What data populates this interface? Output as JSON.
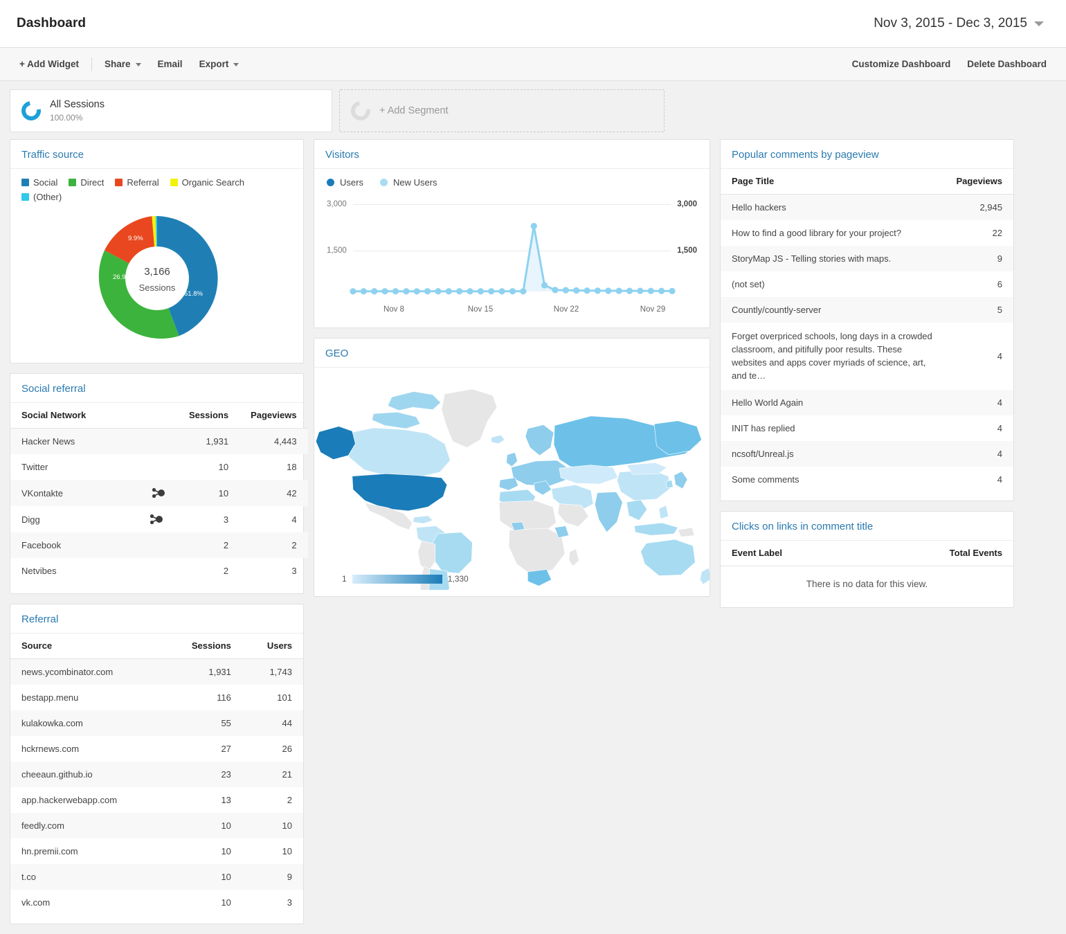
{
  "header": {
    "title": "Dashboard",
    "date_range": "Nov 3, 2015 - Dec 3, 2015"
  },
  "toolbar": {
    "add_widget": "+ Add Widget",
    "share": "Share",
    "email": "Email",
    "export": "Export",
    "customize": "Customize Dashboard",
    "delete": "Delete Dashboard"
  },
  "segments": {
    "all_sessions": {
      "name": "All Sessions",
      "percent": "100.00%"
    },
    "add_segment": "+ Add Segment"
  },
  "traffic_source": {
    "title": "Traffic source",
    "center_value": "3,166",
    "center_label": "Sessions"
  },
  "visitors": {
    "title": "Visitors"
  },
  "geo": {
    "title": "GEO",
    "legend_min": "1",
    "legend_max": "1,330"
  },
  "social_referral": {
    "title": "Social referral",
    "columns": [
      "Social Network",
      "Sessions",
      "Pageviews"
    ],
    "rows": [
      {
        "network": "Hacker News",
        "icon": "",
        "sessions": "1,931",
        "pageviews": "4,443"
      },
      {
        "network": "Twitter",
        "icon": "",
        "sessions": "10",
        "pageviews": "18"
      },
      {
        "network": "VKontakte",
        "icon": "share-network-icon",
        "sessions": "10",
        "pageviews": "42"
      },
      {
        "network": "Digg",
        "icon": "share-network-icon",
        "sessions": "3",
        "pageviews": "4"
      },
      {
        "network": "Facebook",
        "icon": "",
        "sessions": "2",
        "pageviews": "2"
      },
      {
        "network": "Netvibes",
        "icon": "",
        "sessions": "2",
        "pageviews": "3"
      }
    ]
  },
  "referral": {
    "title": "Referral",
    "columns": [
      "Source",
      "Sessions",
      "Users"
    ],
    "rows": [
      {
        "source": "news.ycombinator.com",
        "sessions": "1,931",
        "users": "1,743"
      },
      {
        "source": "bestapp.menu",
        "sessions": "116",
        "users": "101"
      },
      {
        "source": "kulakowka.com",
        "sessions": "55",
        "users": "44"
      },
      {
        "source": "hckrnews.com",
        "sessions": "27",
        "users": "26"
      },
      {
        "source": "cheeaun.github.io",
        "sessions": "23",
        "users": "21"
      },
      {
        "source": "app.hackerwebapp.com",
        "sessions": "13",
        "users": "2"
      },
      {
        "source": "feedly.com",
        "sessions": "10",
        "users": "10"
      },
      {
        "source": "hn.premii.com",
        "sessions": "10",
        "users": "10"
      },
      {
        "source": "t.co",
        "sessions": "10",
        "users": "9"
      },
      {
        "source": "vk.com",
        "sessions": "10",
        "users": "3"
      }
    ]
  },
  "popular_comments": {
    "title": "Popular comments by pageview",
    "columns": [
      "Page Title",
      "Pageviews"
    ],
    "rows": [
      {
        "title": "Hello hackers",
        "pageviews": "2,945"
      },
      {
        "title": "How to find a good library for your project?",
        "pageviews": "22"
      },
      {
        "title": "StoryMap JS - Telling stories with maps.",
        "pageviews": "9"
      },
      {
        "title": "(not set)",
        "pageviews": "6"
      },
      {
        "title": "Countly/countly-server",
        "pageviews": "5"
      },
      {
        "title": "Forget overpriced schools, long days in a crowded classroom, and pitifully poor results. These websites and apps cover myriads of science, art, and te…",
        "pageviews": "4"
      },
      {
        "title": "Hello World Again",
        "pageviews": "4"
      },
      {
        "title": "INIT has replied",
        "pageviews": "4"
      },
      {
        "title": "ncsoft/Unreal.js",
        "pageviews": "4"
      },
      {
        "title": "Some comments",
        "pageviews": "4"
      }
    ]
  },
  "clicks_widget": {
    "title": "Clicks on links in comment title",
    "columns": [
      "Event Label",
      "Total Events"
    ],
    "empty_message": "There is no data for this view."
  },
  "chart_data": [
    {
      "type": "pie",
      "title": "Traffic source",
      "labels": [
        "Social",
        "Direct",
        "Referral",
        "Organic Search",
        "(Other)"
      ],
      "values": [
        61.8,
        26.9,
        9.9,
        1.1,
        0.3
      ],
      "value_labels": [
        "61.8%",
        "26.9%",
        "9.9%",
        "",
        ""
      ],
      "colors": [
        "#1f7fb5",
        "#3cb33c",
        "#e8471f",
        "#f2f20d",
        "#2fc9ea"
      ],
      "center_value": "3,166",
      "center_label": "Sessions",
      "legend": "top",
      "donut": true
    },
    {
      "type": "line",
      "title": "Visitors",
      "xlabel": "",
      "ylabel": "",
      "ylim": [
        0,
        3000
      ],
      "yticks": [
        1500,
        3000
      ],
      "ytick_labels": [
        "1,500",
        "3,000"
      ],
      "grid": true,
      "legend": "top",
      "x_tick_labels": [
        "Nov 8",
        "Nov 15",
        "Nov 22",
        "Nov 29"
      ],
      "x_tick_indices": [
        5,
        12,
        19,
        26
      ],
      "x": [
        "Nov 3",
        "Nov 4",
        "Nov 5",
        "Nov 6",
        "Nov 7",
        "Nov 8",
        "Nov 9",
        "Nov 10",
        "Nov 11",
        "Nov 12",
        "Nov 13",
        "Nov 14",
        "Nov 15",
        "Nov 16",
        "Nov 17",
        "Nov 18",
        "Nov 19",
        "Nov 20",
        "Nov 21",
        "Nov 22",
        "Nov 23",
        "Nov 24",
        "Nov 25",
        "Nov 26",
        "Nov 27",
        "Nov 28",
        "Nov 29",
        "Nov 30",
        "Dec 1",
        "Dec 2",
        "Dec 3"
      ],
      "series": [
        {
          "name": "Users",
          "color": "#1a7cb8",
          "values": [
            6,
            8,
            7,
            9,
            8,
            7,
            6,
            9,
            8,
            7,
            9,
            8,
            7,
            8,
            6,
            9,
            8,
            2280,
            230,
            60,
            55,
            40,
            35,
            30,
            28,
            26,
            25,
            24,
            22,
            20,
            18
          ]
        },
        {
          "name": "New Users",
          "color": "#8ed2f0",
          "values": [
            5,
            7,
            6,
            8,
            7,
            6,
            5,
            8,
            7,
            6,
            8,
            7,
            6,
            7,
            5,
            8,
            7,
            2250,
            215,
            50,
            45,
            35,
            30,
            26,
            24,
            22,
            21,
            20,
            19,
            17,
            15
          ]
        }
      ]
    },
    {
      "type": "heatmap",
      "title": "GEO",
      "subtype": "choropleth-world-map",
      "legend_min": 1,
      "legend_max": 1330,
      "legend_min_label": "1",
      "legend_max_label": "1,330",
      "color_scale": [
        "#d7edfb",
        "#1a7cb8"
      ],
      "no_data_color": "#e6e6e6",
      "highlighted_regions": [
        {
          "name": "United States",
          "value": 1330,
          "color": "#1a7cb8"
        },
        {
          "name": "Alaska",
          "value": 1330,
          "color": "#1a7cb8"
        },
        {
          "name": "Russia",
          "value": 400,
          "color": "#6dc1e8"
        },
        {
          "name": "Canada",
          "value": 260,
          "color": "#9fd6ef"
        },
        {
          "name": "Europe",
          "value": 200,
          "color": "#8ecdec"
        },
        {
          "name": "India",
          "value": 150,
          "color": "#8ecdec"
        },
        {
          "name": "Australia",
          "value": 120,
          "color": "#a7dbf1"
        },
        {
          "name": "Brazil",
          "value": 100,
          "color": "#a7dbf1"
        },
        {
          "name": "China",
          "value": 90,
          "color": "#bfe4f6"
        },
        {
          "name": "Greenland",
          "value": 0,
          "color": "#e6e6e6"
        },
        {
          "name": "Africa (most)",
          "value": 0,
          "color": "#e6e6e6"
        }
      ]
    },
    {
      "type": "table",
      "title": "Social referral",
      "columns": [
        "Social Network",
        "Sessions",
        "Pageviews"
      ],
      "rows": [
        [
          "Hacker News",
          "1,931",
          "4,443"
        ],
        [
          "Twitter",
          "10",
          "18"
        ],
        [
          "VKontakte",
          "10",
          "42"
        ],
        [
          "Digg",
          "3",
          "4"
        ],
        [
          "Facebook",
          "2",
          "2"
        ],
        [
          "Netvibes",
          "2",
          "3"
        ]
      ]
    },
    {
      "type": "table",
      "title": "Referral",
      "columns": [
        "Source",
        "Sessions",
        "Users"
      ],
      "rows": [
        [
          "news.ycombinator.com",
          "1,931",
          "1,743"
        ],
        [
          "bestapp.menu",
          "116",
          "101"
        ],
        [
          "kulakowka.com",
          "55",
          "44"
        ],
        [
          "hckrnews.com",
          "27",
          "26"
        ],
        [
          "cheeaun.github.io",
          "23",
          "21"
        ],
        [
          "app.hackerwebapp.com",
          "13",
          "2"
        ],
        [
          "feedly.com",
          "10",
          "10"
        ],
        [
          "hn.premii.com",
          "10",
          "10"
        ],
        [
          "t.co",
          "10",
          "9"
        ],
        [
          "vk.com",
          "10",
          "3"
        ]
      ]
    },
    {
      "type": "table",
      "title": "Popular comments by pageview",
      "columns": [
        "Page Title",
        "Pageviews"
      ],
      "rows": [
        [
          "Hello hackers",
          "2,945"
        ],
        [
          "How to find a good library for your project?",
          "22"
        ],
        [
          "StoryMap JS - Telling stories with maps.",
          "9"
        ],
        [
          "(not set)",
          "6"
        ],
        [
          "Countly/countly-server",
          "5"
        ],
        [
          "Forget overpriced schools, long days in a crowded classroom, and pitifully poor results. These websites and apps cover myriads of science, art, and te…",
          "4"
        ],
        [
          "Hello World Again",
          "4"
        ],
        [
          "INIT has replied",
          "4"
        ],
        [
          "ncsoft/Unreal.js",
          "4"
        ],
        [
          "Some comments",
          "4"
        ]
      ]
    }
  ]
}
